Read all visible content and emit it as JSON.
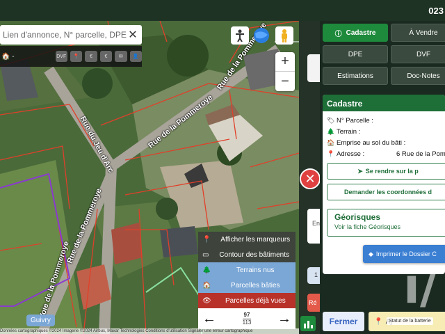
{
  "header": {
    "number": "023"
  },
  "search": {
    "placeholder": "Lien d'annonce, N° parcelle, DPE",
    "clear_glyph": "✕",
    "sub_prefix": "🏠 -",
    "sub_icons": [
      "DVF",
      "📍",
      "€",
      "€",
      "✉",
      "👤"
    ]
  },
  "map": {
    "roads": [
      "Rue de la Pommeroye",
      "Rue de la Pommeroye",
      "Rue du Jeu d'Arc",
      "Rue de la Pommeroye",
      "Voie de la Pommeroye"
    ],
    "place_label": "Guivry",
    "attribution": "Données cartographiques ©2024 Imagerie ©2024 Airbus, Maxar Technologies   Conditions d'utilisation   Signaler une erreur cartographique",
    "zoom_in": "+",
    "zoom_out": "−"
  },
  "legend": {
    "items": [
      {
        "label": "Afficher les marqueurs",
        "icon": "📍"
      },
      {
        "label": "Contour des bâtiments",
        "icon": "▭"
      },
      {
        "label": "Terrains nus",
        "icon": "🌲"
      },
      {
        "label": "Parcelles bâties",
        "icon": "🏠"
      },
      {
        "label": "Parcelles déjà vues",
        "icon": "👁"
      }
    ],
    "prev": "←",
    "next": "→",
    "current": "97",
    "total": "113"
  },
  "panel": {
    "tabs": [
      "Cadastre",
      "À Vendre",
      "DPE",
      "DVF",
      "Estimations",
      "Doc-Notes"
    ],
    "card_title": "Cadastre",
    "rows": [
      {
        "label": "N° Parcelle :",
        "value": ""
      },
      {
        "label": "Terrain :",
        "value": ""
      },
      {
        "label": "Emprise au sol du bâti :",
        "value": ""
      },
      {
        "label": "Adresse :",
        "value": "6 Rue de la Pomm"
      }
    ],
    "go_btn": "Se rendre sur la p",
    "coords_btn": "Demander les coordonnées d",
    "geo_title": "Géorisques",
    "geo_sub": "Voir la fiche Géorisques",
    "print_btn": "Imprimer le Dossier C"
  },
  "strip": {
    "labels": [
      "En",
      "1",
      "Ré"
    ]
  },
  "bottom": {
    "close": "Fermer",
    "add": "Aj",
    "status_tip": "Statut de la batterie"
  },
  "watermark": "i/"
}
